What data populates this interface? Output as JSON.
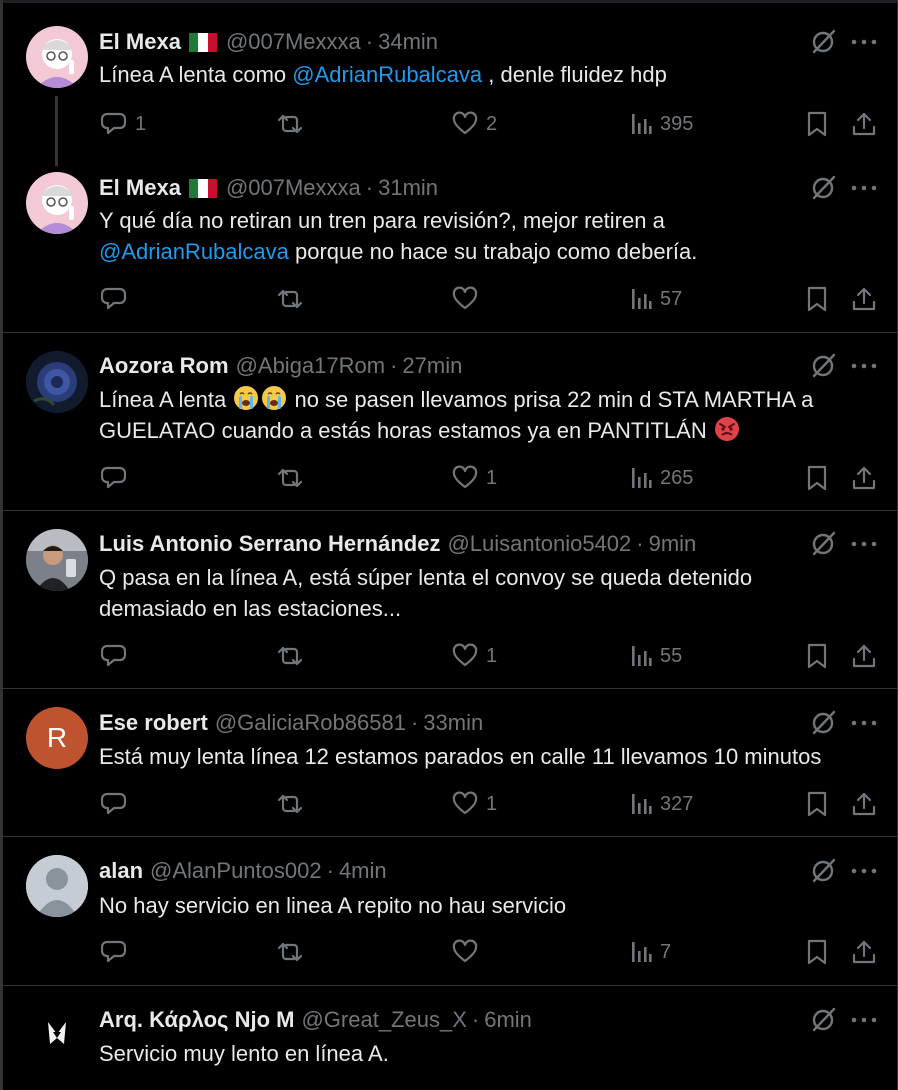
{
  "tweets": [
    {
      "name": "El Mexa",
      "has_flag": true,
      "handle": "@007Mexxxa",
      "time": "34min",
      "text_a": "Línea A lenta como ",
      "mention": "@AdrianRubalcava",
      "text_b": " , denle fluidez hdp",
      "reply_count": "1",
      "like_count": "2",
      "view_count": "395"
    },
    {
      "name": "El Mexa",
      "has_flag": true,
      "handle": "@007Mexxxa",
      "time": "31min",
      "line1": "Y qué día no retiran un tren para revisión?, mejor retiren a",
      "mention": "@AdrianRubalcava",
      "line2_rest": " porque no hace su trabajo como debería.",
      "view_count": "57"
    },
    {
      "name": "Aozora Rom",
      "handle": "@Abiga17Rom",
      "time": "27min",
      "line1_a": "Línea A lenta ",
      "line1_b": " no se pasen llevamos prisa 22 min d STA MARTHA a",
      "line2": "GUELATAO cuando a estás horas estamos ya en PANTITLÁN ",
      "like_count": "1",
      "view_count": "265"
    },
    {
      "name": "Luis Antonio Serrano Hernández",
      "handle": "@Luisantonio5402",
      "time": "9min",
      "line1": "Q pasa en la línea A, está súper lenta el convoy se queda detenido",
      "line2": "demasiado en las estaciones...",
      "like_count": "1",
      "view_count": "55"
    },
    {
      "name": "Ese robert",
      "handle": "@GaliciaRob86581",
      "time": "33min",
      "avatar_letter": "R",
      "line1": "Está muy lenta línea 12 estamos parados en calle 11 llevamos 10 minutos",
      "like_count": "1",
      "view_count": "327"
    },
    {
      "name": "alan",
      "handle": "@AlanPuntos002",
      "time": "4min",
      "line1": "No hay servicio en linea A repito no hau servicio",
      "view_count": "7"
    },
    {
      "name": "Arq. Κάρλος Njo M",
      "handle": "@Great_Zeus_X",
      "time": "6min",
      "line1": "Servicio muy lento en línea A."
    }
  ],
  "separator": "·",
  "colors": {
    "background": "#000000",
    "text": "#e7e9ea",
    "muted": "#71767b",
    "mention": "#1d9bf0",
    "divider": "#2f3336",
    "avatar_r": "#c0532f"
  },
  "icons": [
    "reply-icon",
    "retweet-icon",
    "like-icon",
    "views-icon",
    "bookmark-icon",
    "share-icon",
    "grok-icon",
    "more-icon",
    "flag-mexico-icon",
    "crying-emoji",
    "angry-emoji"
  ]
}
